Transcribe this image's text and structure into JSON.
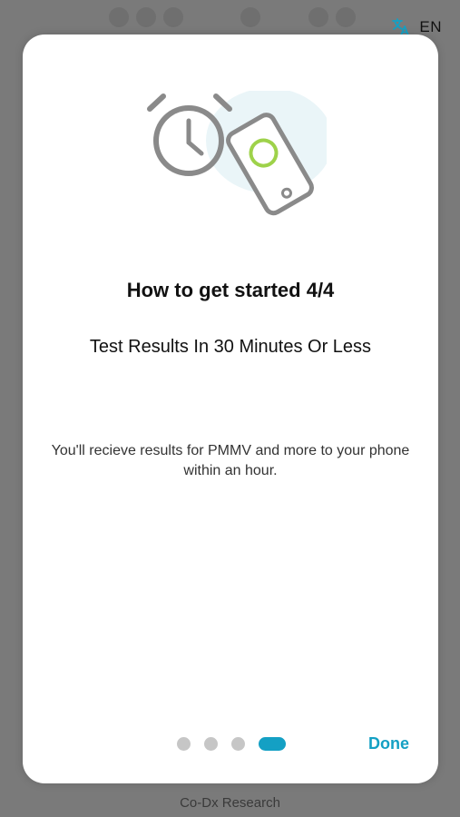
{
  "language": {
    "icon": "translate-icon",
    "code": "EN"
  },
  "modal": {
    "illustration": {
      "icons": [
        "stopwatch-icon",
        "smartphone-icon"
      ]
    },
    "title": "How to get started 4/4",
    "subtitle": "Test Results In 30 Minutes Or Less",
    "body": "You'll recieve results for PMMV and more to your phone within an hour.",
    "pager": {
      "total": 4,
      "current": 4
    },
    "done_label": "Done"
  },
  "footer": {
    "text": "Co-Dx Research"
  },
  "colors": {
    "accent": "#14a0c4",
    "inactive_dot": "#c6c6c6",
    "overlay": "#7a7a7a",
    "icon_stroke": "#8a8a8a",
    "icon_highlight": "#9ed24a",
    "icon_blob": "#eaf5f8"
  }
}
